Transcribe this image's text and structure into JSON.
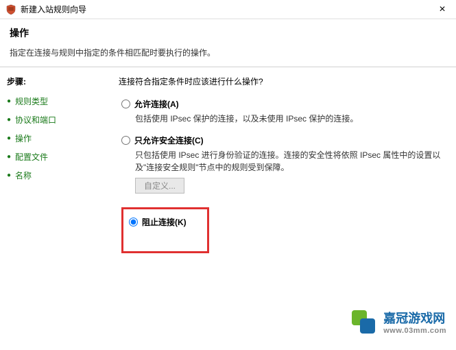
{
  "window": {
    "title": "新建入站规则向导",
    "close": "×"
  },
  "header": {
    "title": "操作",
    "subtitle": "指定在连接与规则中指定的条件相匹配时要执行的操作。"
  },
  "sidebar": {
    "steps_label": "步骤:",
    "items": [
      {
        "label": "规则类型"
      },
      {
        "label": "协议和端口"
      },
      {
        "label": "操作"
      },
      {
        "label": "配置文件"
      },
      {
        "label": "名称"
      }
    ]
  },
  "content": {
    "question": "连接符合指定条件时应该进行什么操作?",
    "options": {
      "allow": {
        "label": "允许连接(A)",
        "desc": "包括使用 IPsec 保护的连接，以及未使用 IPsec 保护的连接。"
      },
      "allow_secure": {
        "label": "只允许安全连接(C)",
        "desc": "只包括使用 IPsec 进行身份验证的连接。连接的安全性将依照 IPsec 属性中的设置以及\"连接安全规则\"节点中的规则受到保障。",
        "custom_btn": "自定义..."
      },
      "block": {
        "label": "阻止连接(K)"
      }
    }
  },
  "watermark": {
    "text": "嘉冠游戏网",
    "url": "www.03mm.com"
  }
}
